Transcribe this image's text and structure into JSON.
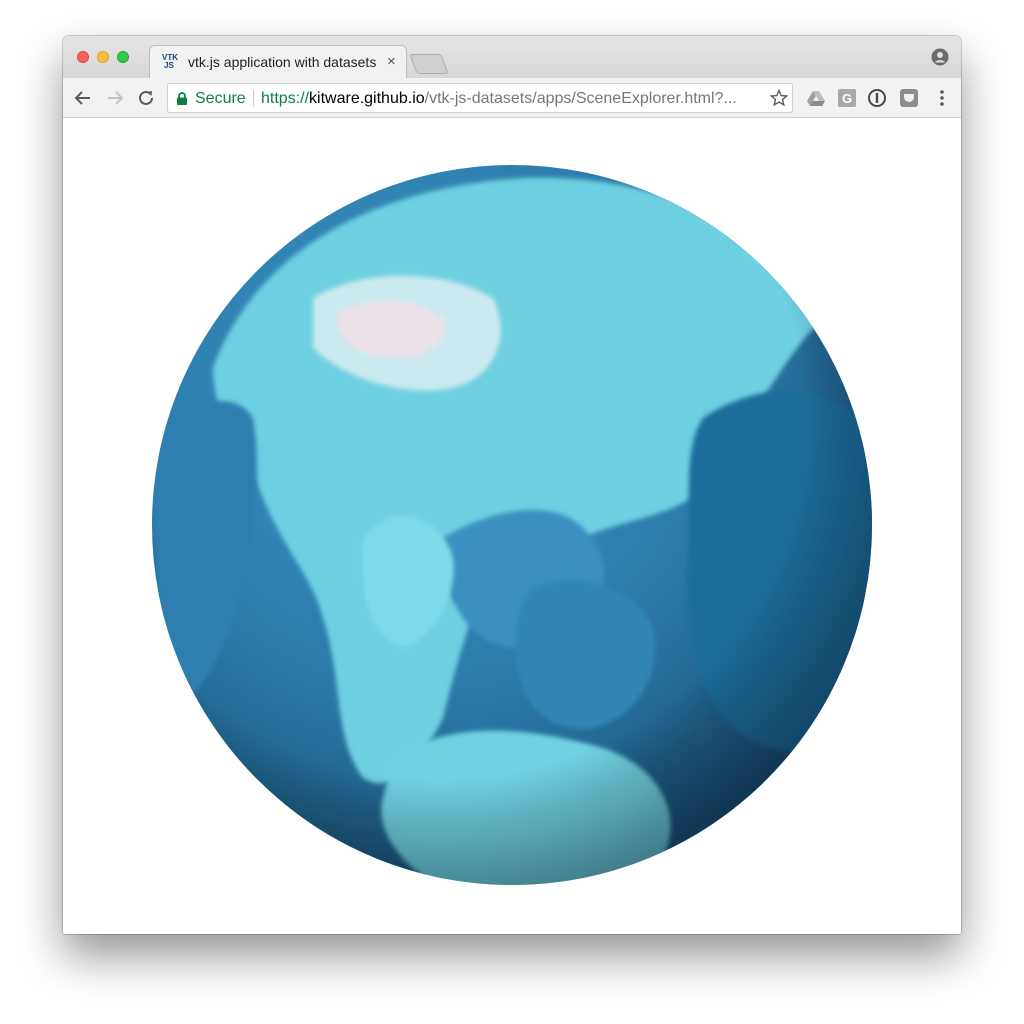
{
  "tab": {
    "title": "vtk.js application with datasets",
    "favicon_text_top": "VTK",
    "favicon_text_bottom": "JS",
    "close_glyph": "×"
  },
  "address_bar": {
    "secure_label": "Secure",
    "url_scheme": "https://",
    "url_host": "kitware.github.io",
    "url_path": "/vtk-js-datasets/apps/SceneExplorer.html?..."
  },
  "icons": {
    "back": "arrow-left-icon",
    "forward": "arrow-right-icon",
    "reload": "reload-icon",
    "lock": "lock-icon",
    "bookmark": "star-icon",
    "ext1": "google-drive-icon",
    "ext2": "google-translate-icon",
    "ext3": "password-manager-icon",
    "ext4": "pocket-icon",
    "menu": "more-vertical-icon",
    "profile": "user-account-icon"
  },
  "colors": {
    "secure_green": "#0b8043",
    "ocean_dark": "#1d5f86",
    "ocean_mid": "#2a7fb0",
    "land_light": "#6ed0e2",
    "snow": "#e8e4ea"
  }
}
